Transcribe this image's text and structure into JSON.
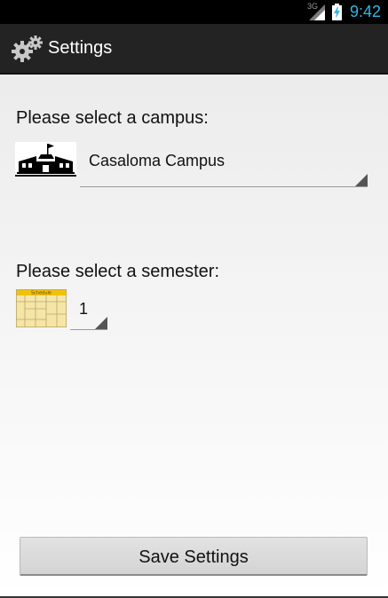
{
  "status_bar": {
    "network": "3G",
    "time": "9:42"
  },
  "action_bar": {
    "title": "Settings",
    "icon": "gear-icon"
  },
  "campus": {
    "label": "Please select a campus:",
    "selected": "Casaloma Campus",
    "icon": "school-icon"
  },
  "semester": {
    "label": "Please select a semester:",
    "selected": "1",
    "icon": "calendar-icon",
    "icon_title": "Schedule"
  },
  "save_button": {
    "label": "Save Settings"
  },
  "colors": {
    "accent": "#33b5e5",
    "action_bar": "#232323",
    "status_bar": "#000000"
  }
}
